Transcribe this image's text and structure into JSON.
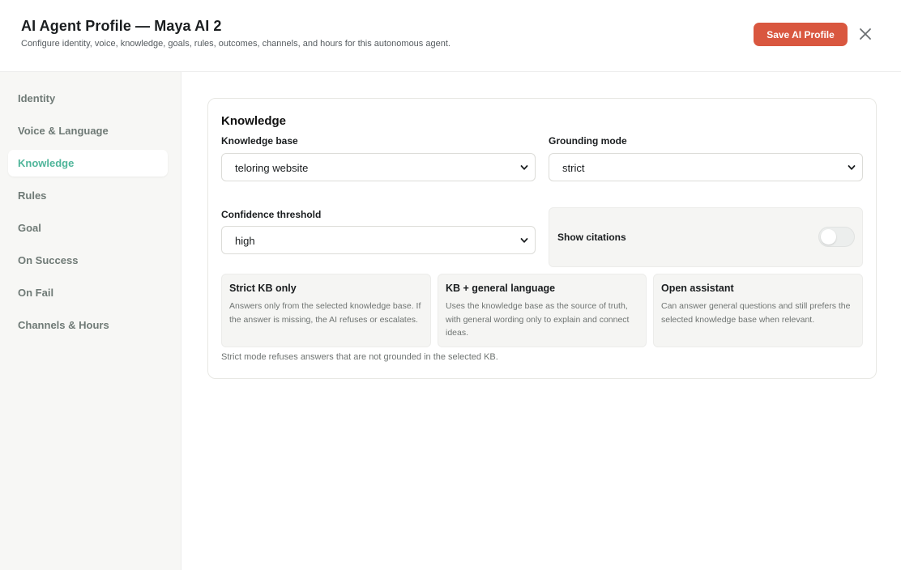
{
  "header": {
    "title": "AI Agent Profile — Maya AI 2",
    "subtitle": "Configure identity, voice, knowledge, goals, rules, outcomes, channels, and hours for this autonomous agent.",
    "save_label": "Save AI Profile",
    "close_icon": "close-icon"
  },
  "sidebar": {
    "items": [
      {
        "label": "Identity",
        "active": false
      },
      {
        "label": "Voice & Language",
        "active": false
      },
      {
        "label": "Knowledge",
        "active": true
      },
      {
        "label": "Rules",
        "active": false
      },
      {
        "label": "Goal",
        "active": false
      },
      {
        "label": "On Success",
        "active": false
      },
      {
        "label": "On Fail",
        "active": false
      },
      {
        "label": "Channels & Hours",
        "active": false
      }
    ]
  },
  "knowledge": {
    "section_title": "Knowledge",
    "knowledge_base": {
      "label": "Knowledge base",
      "value": "teloring website"
    },
    "grounding_mode": {
      "label": "Grounding mode",
      "value": "strict"
    },
    "confidence_threshold": {
      "label": "Confidence threshold",
      "value": "high"
    },
    "show_citations": {
      "label": "Show citations",
      "enabled": false
    },
    "modes": [
      {
        "title": "Strict KB only",
        "description": "Answers only from the selected knowledge base. If the answer is missing, the AI refuses or escalates."
      },
      {
        "title": "KB + general language",
        "description": "Uses the knowledge base as the source of truth, with general wording only to explain and connect ideas."
      },
      {
        "title": "Open assistant",
        "description": "Can answer general questions and still prefers the selected knowledge base when relevant."
      }
    ],
    "note": "Strict mode refuses answers that are not grounded in the selected KB."
  },
  "colors": {
    "accent": "#4fb59a",
    "save_button": "#d9573f",
    "sidebar_bg": "#f7f7f5"
  }
}
